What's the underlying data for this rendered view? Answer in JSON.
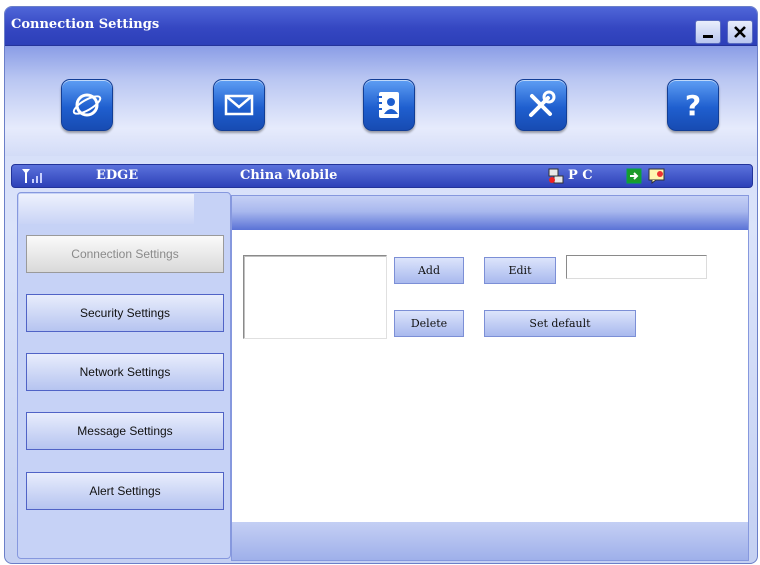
{
  "window": {
    "title": "Connection Settings"
  },
  "titlebar": {
    "minimize_label": "_",
    "close_label": "✕"
  },
  "toolbar": {
    "icons": [
      "internet-icon",
      "message-icon",
      "contacts-icon",
      "settings-tools-icon",
      "help-icon"
    ]
  },
  "status": {
    "network_type": "EDGE",
    "operator": "China Mobile",
    "mode": "P C"
  },
  "sidebar": {
    "items": [
      {
        "label": "Connection Settings",
        "active": true
      },
      {
        "label": "Security Settings",
        "active": false
      },
      {
        "label": "Network Settings",
        "active": false
      },
      {
        "label": "Message Settings",
        "active": false
      },
      {
        "label": "Alert Settings",
        "active": false
      }
    ]
  },
  "panel": {
    "add_label": "Add",
    "edit_label": "Edit",
    "delete_label": "Delete",
    "set_default_label": "Set default",
    "name_value": ""
  },
  "colors": {
    "title_bar": "#3547c2",
    "toolbar_icon": "#1f5fcf",
    "status_bar": "#2d41b8",
    "panel_border": "#8698de"
  }
}
